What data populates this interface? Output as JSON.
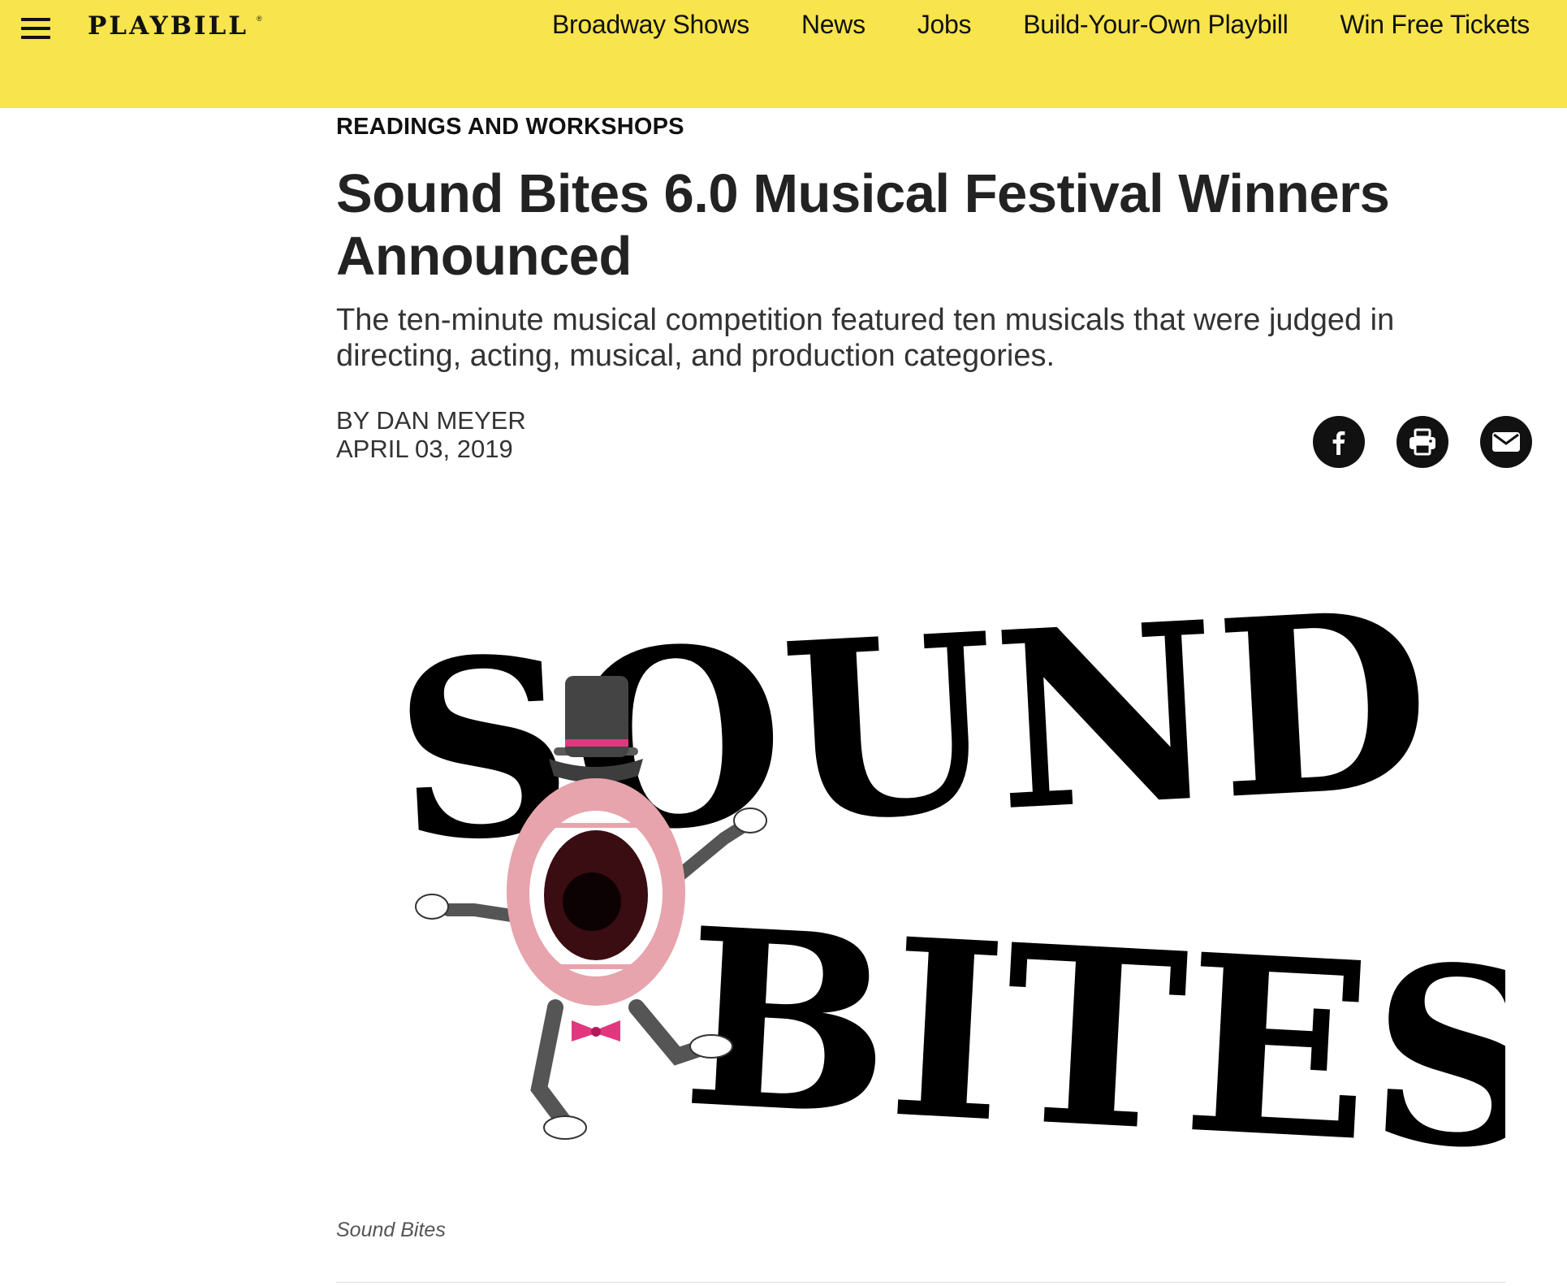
{
  "colors": {
    "brand": "#f8e44c",
    "text": "#222222",
    "icon_bg": "#111111"
  },
  "header": {
    "logo": "PLAYBILL",
    "logo_mark": "®",
    "menu_icon": "hamburger-menu-icon",
    "nav": [
      "Broadway Shows",
      "News",
      "Jobs",
      "Build-Your-Own Playbill",
      "Win Free Tickets"
    ]
  },
  "article": {
    "category": "READINGS AND WORKSHOPS",
    "title": "Sound Bites 6.0 Musical Festival Winners Announced",
    "dek": "The ten-minute musical competition featured ten musicals that were judged in directing, acting, musical, and production categories.",
    "byline": "BY DAN MEYER",
    "date": "APRIL 03, 2019",
    "share_icons": [
      "facebook-icon",
      "print-icon",
      "email-icon"
    ]
  },
  "hero": {
    "logo_words": [
      "SOUND",
      "BITES"
    ],
    "caption": "Sound Bites"
  }
}
